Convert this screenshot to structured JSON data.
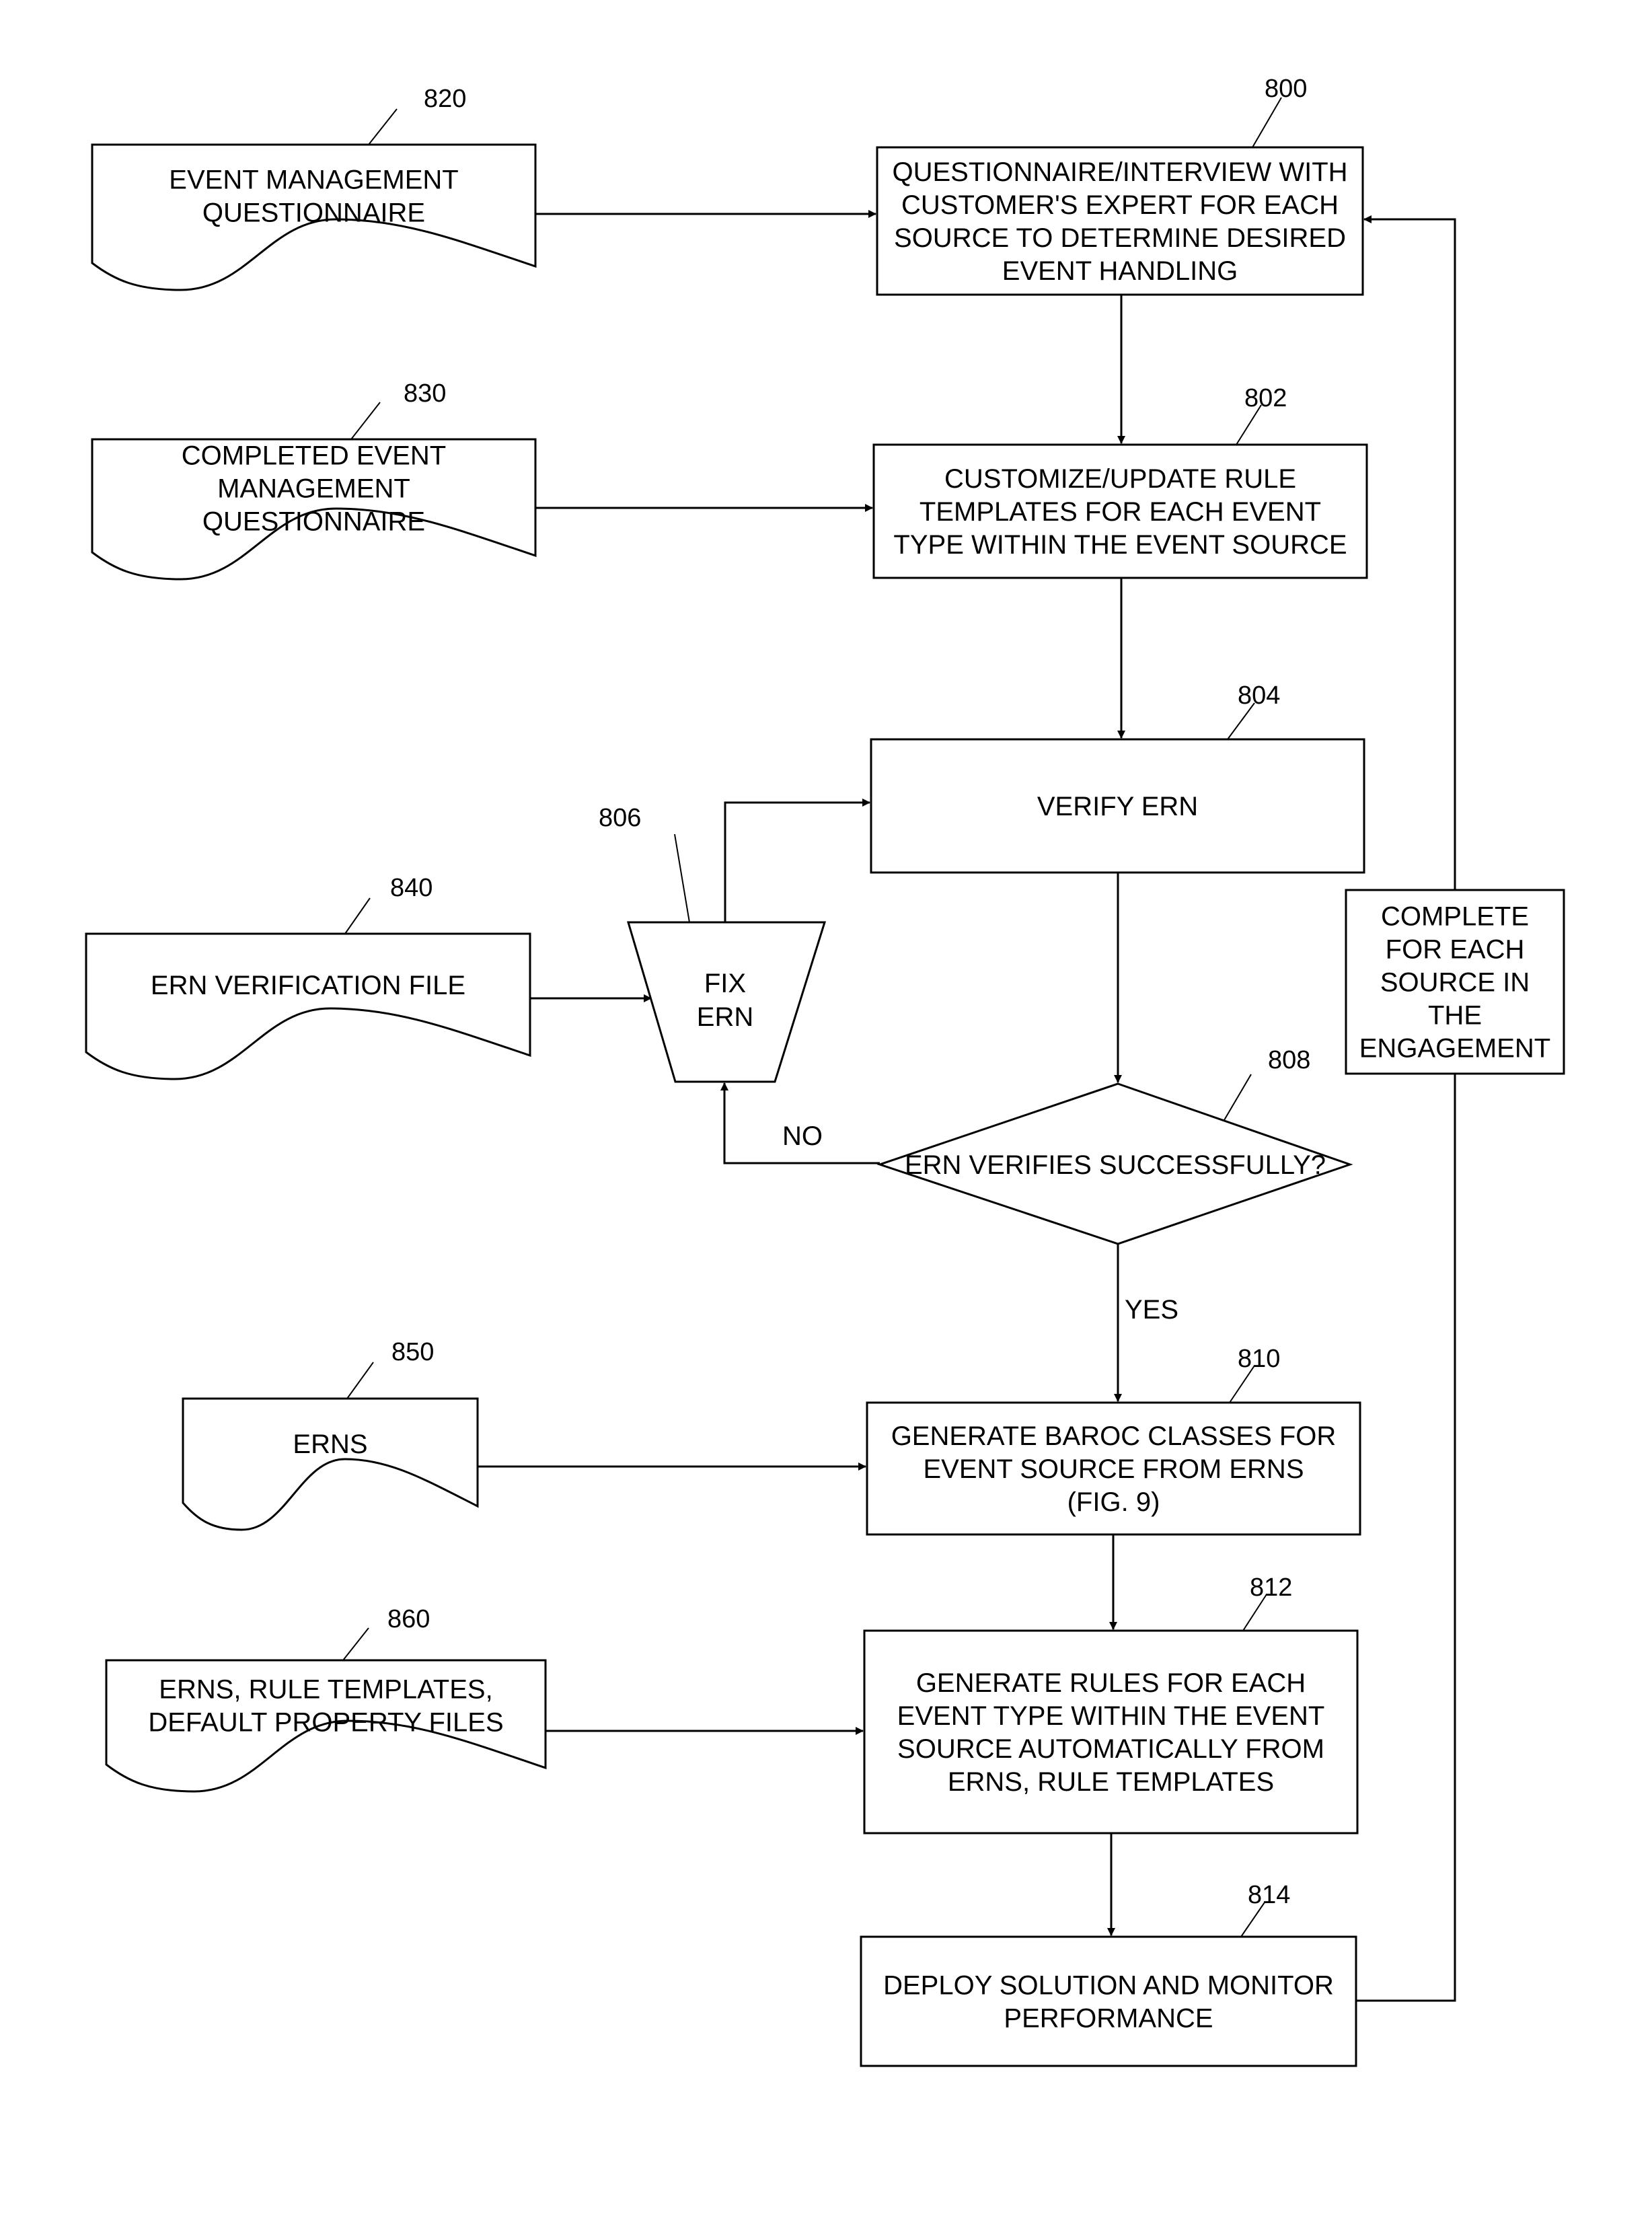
{
  "figure": {
    "nodes": [
      {
        "id": "800",
        "type": "process",
        "lines": [
          "QUESTIONNAIRE/INTERVIEW WITH",
          "CUSTOMER'S EXPERT FOR EACH",
          "SOURCE TO DETERMINE DESIRED",
          "EVENT HANDLING"
        ]
      },
      {
        "id": "802",
        "type": "process",
        "lines": [
          "CUSTOMIZE/UPDATE RULE",
          "TEMPLATES FOR EACH EVENT",
          "TYPE WITHIN THE EVENT SOURCE"
        ]
      },
      {
        "id": "804",
        "type": "process",
        "lines": [
          "VERIFY ERN"
        ]
      },
      {
        "id": "806",
        "type": "manual-operation",
        "lines": [
          "FIX",
          "ERN"
        ]
      },
      {
        "id": "808",
        "type": "decision",
        "lines": [
          "ERN VERIFIES SUCCESSFULLY?"
        ]
      },
      {
        "id": "810",
        "type": "process",
        "lines": [
          "GENERATE BAROC CLASSES FOR",
          "EVENT SOURCE FROM ERNS",
          "(FIG. 9)"
        ]
      },
      {
        "id": "812",
        "type": "process",
        "lines": [
          "GENERATE RULES FOR EACH",
          "EVENT TYPE WITHIN THE EVENT",
          "SOURCE AUTOMATICALLY FROM",
          "ERNS, RULE TEMPLATES"
        ]
      },
      {
        "id": "814",
        "type": "process",
        "lines": [
          "DEPLOY SOLUTION AND MONITOR",
          "PERFORMANCE"
        ]
      },
      {
        "id": "820",
        "type": "document",
        "lines": [
          "EVENT MANAGEMENT",
          "QUESTIONNAIRE"
        ]
      },
      {
        "id": "830",
        "type": "document",
        "lines": [
          "COMPLETED EVENT",
          "MANAGEMENT",
          "QUESTIONNAIRE"
        ]
      },
      {
        "id": "840",
        "type": "document",
        "lines": [
          "ERN VERIFICATION FILE"
        ]
      },
      {
        "id": "850",
        "type": "document",
        "lines": [
          "ERNS"
        ]
      },
      {
        "id": "860",
        "type": "document",
        "lines": [
          "ERNS, RULE TEMPLATES,",
          "DEFAULT PROPERTY FILES"
        ]
      },
      {
        "id": "loop",
        "type": "annotation",
        "lines": [
          "COMPLETE",
          "FOR EACH",
          "SOURCE IN",
          "THE",
          "ENGAGEMENT"
        ]
      }
    ],
    "edges": [
      {
        "from": "820",
        "to": "800",
        "label": ""
      },
      {
        "from": "800",
        "to": "802",
        "label": ""
      },
      {
        "from": "830",
        "to": "802",
        "label": ""
      },
      {
        "from": "802",
        "to": "804",
        "label": ""
      },
      {
        "from": "804",
        "to": "808",
        "label": ""
      },
      {
        "from": "840",
        "to": "806",
        "label": ""
      },
      {
        "from": "806",
        "to": "804",
        "label": ""
      },
      {
        "from": "808",
        "to": "806",
        "label": "NO"
      },
      {
        "from": "808",
        "to": "810",
        "label": "YES"
      },
      {
        "from": "850",
        "to": "810",
        "label": ""
      },
      {
        "from": "810",
        "to": "812",
        "label": ""
      },
      {
        "from": "860",
        "to": "812",
        "label": ""
      },
      {
        "from": "812",
        "to": "814",
        "label": ""
      },
      {
        "from": "814",
        "to": "800",
        "label": "COMPLETE FOR EACH SOURCE IN THE ENGAGEMENT"
      }
    ],
    "edge_labels": {
      "no": "NO",
      "yes": "YES"
    }
  }
}
